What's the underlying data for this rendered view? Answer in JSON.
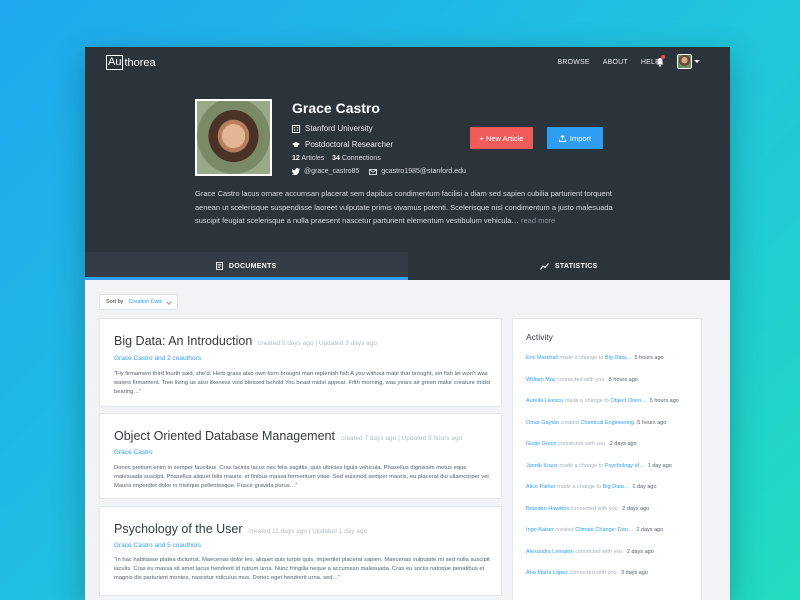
{
  "app": {
    "logo_box": "Au",
    "logo_rest": "thorea",
    "nav": [
      "BROWSE",
      "ABOUT",
      "HELP"
    ]
  },
  "profile": {
    "name": "Grace Castro",
    "institution": "Stanford University",
    "position": "Postdoctoral Researcher",
    "articles_count": "12",
    "articles_label": "Articles",
    "connections_count": "34",
    "connections_label": "Connections",
    "twitter": "@grace_castro85",
    "email": "gcastro1985@stanford.edu",
    "bio": "Grace Castro lacus ornare accumsan placerat sem dapibus condimentum facilisi a diam sed sapien cubilia parturient torquent aenean ut scelerisque suspendisse laoreet vulputate primis vivamus potenti. Scelerisque nisl condimentum a justo malesuada suscipit feugiat scelerisque a nulla praesent nascetur parturient elementum vestibulum vehicula…",
    "read_more": "read more"
  },
  "actions": {
    "new_article": "+ New Article",
    "import": "Import"
  },
  "tabs": {
    "documents": "DOCUMENTS",
    "statistics": "STATISTICS"
  },
  "sort": {
    "label": "Sort by",
    "value": "Creation Date"
  },
  "articles": [
    {
      "title": "Big Data: An Introduction",
      "meta": "created 5 days ago  |  Updated 3 days ago",
      "authors": "Grace Castro and 2 coauthors",
      "excerpt": "“Fly firmament third fourth said, she’d. Herb grass also own form brought man replenish fish A you without male that brought, set fish let won’t was waters firmament. Tree living us also likeness void blessed behold You beast midst appear. Fifth morning, was years air green make creature midst bearing…”"
    },
    {
      "title": "Object Oriented Database Management",
      "meta": "created 7 days ago  |  Updated 5 hours ago",
      "authors": "Grace Castro",
      "excerpt": "Donec pretium enim in semper faucibus. Cras lacinia lacus nec felis sagittis, quis ultricies ligula vehicula. Phasellus dignissim metus eque malesuada suscipit. Phasellus aliquet felis mauris, et finibus massa fermentum vitae. Sed euismod semper mauris, eu placerat dui ullamcorper vel. Mauris imperdiet dolor in tristique pellentesque. Fusce gravida purus…”"
    },
    {
      "title": "Psychology of the User",
      "meta": "created 11 days ago  |  Updated 1 day ago",
      "authors": "Grace Castro and 5 coauthors",
      "excerpt": "“In hac habitasse platea dictumst. Maecenas dolor leo, aliquet quis turpis quis, imperdiet placerat sapien. Maecenas vulputate mi sed nulla suscipit iaculis. Cras eu massa sit amet lacus hendrerit id rutrum urna. Nunc fringilla neque a accumsan malesuada. Cras eu sociis natoque penatibus et magnis dis parturient montes, nascetur ridiculus mus. Donec eget hendrerit urna, sed…”"
    }
  ],
  "activity": {
    "heading": "Activity",
    "items": [
      {
        "who": "Eric Marshall",
        "action": "made a change to",
        "what": "Big Data…",
        "when": "5 hours ago"
      },
      {
        "who": "William May",
        "action": "connected with you",
        "what": "",
        "when": "5 hours ago"
      },
      {
        "who": "Aurelia Livescu",
        "action": "made a change to",
        "what": "Object Orien…",
        "when": "5 hours ago"
      },
      {
        "who": "Omar Gaytán",
        "action": "created",
        "what": "Chemical Engineering",
        "when": "5 hours ago"
      },
      {
        "who": "Giulio Greco",
        "action": "connected with you",
        "what": "",
        "when": "2 days ago"
      },
      {
        "who": "Jannik Kraus",
        "action": "made a change to",
        "what": "Psychology of…",
        "when": "1 day ago"
      },
      {
        "who": "Alice Parker",
        "action": "made a change to",
        "what": "Big Data…",
        "when": "1 day ago"
      },
      {
        "who": "Brandon Hawkins",
        "action": "connected with you",
        "what": "",
        "when": "2 days ago"
      },
      {
        "who": "Ingo Kaiser",
        "action": "created",
        "what": "Climate Change: Dan…",
        "when": "2 days ago"
      },
      {
        "who": "Alexandra Lemaitre",
        "action": "connected with you",
        "what": "",
        "when": "2 days ago"
      },
      {
        "who": "Ana María López",
        "action": "connected with you",
        "what": "",
        "when": "3 days ago"
      }
    ]
  },
  "colors": {
    "header_bg": "#2b333b",
    "accent_blue": "#2e9df2",
    "accent_red": "#ef5b5b"
  }
}
